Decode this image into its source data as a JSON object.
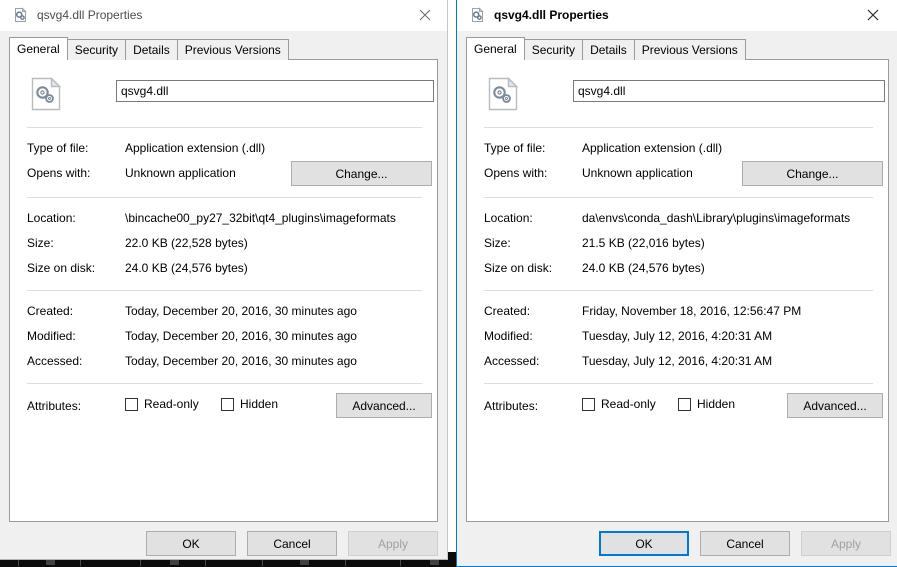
{
  "desktop": {
    "taskbar_present": true,
    "taskbar_color": "#0b0b0b"
  },
  "theme": {
    "accent": "#0078d7",
    "dialog_bg": "#f0f0f0",
    "panel_bg": "#ffffff",
    "button_bg": "#e1e1e1",
    "button_border": "#adadad",
    "separator": "#dedede",
    "disabled_text": "#a0a0a0"
  },
  "tabs": [
    {
      "label": "General",
      "selected": true
    },
    {
      "label": "Security",
      "selected": false
    },
    {
      "label": "Details",
      "selected": false
    },
    {
      "label": "Previous Versions",
      "selected": false
    }
  ],
  "labels": {
    "type_of_file": "Type of file:",
    "opens_with": "Opens with:",
    "location": "Location:",
    "size": "Size:",
    "size_on_disk": "Size on disk:",
    "created": "Created:",
    "modified": "Modified:",
    "accessed": "Accessed:",
    "attributes": "Attributes:"
  },
  "buttons": {
    "change": "Change...",
    "advanced": "Advanced...",
    "ok": "OK",
    "cancel": "Cancel",
    "apply": "Apply",
    "close": "Close"
  },
  "checkboxes": {
    "readonly": "Read-only",
    "hidden": "Hidden"
  },
  "icons": {
    "titlebar": "file-dll-icon",
    "file": "file-dll-icon",
    "close": "close-icon"
  },
  "dialogs": {
    "left": {
      "title": "qsvg4.dll Properties",
      "active": false,
      "filename": "qsvg4.dll",
      "type_of_file": "Application extension (.dll)",
      "opens_with": "Unknown application",
      "location": "\\bincache00_py27_32bit\\qt4_plugins\\imageformats",
      "size": "22.0 KB (22,528 bytes)",
      "size_on_disk": "24.0 KB (24,576 bytes)",
      "created": "Today, December 20, 2016, 30 minutes ago",
      "modified": "Today, December 20, 2016, 30 minutes ago",
      "accessed": "Today, December 20, 2016, 30 minutes ago",
      "readonly_checked": false,
      "hidden_checked": false,
      "ok_is_default": false,
      "apply_enabled": false
    },
    "right": {
      "title": "qsvg4.dll Properties",
      "active": true,
      "filename": "qsvg4.dll",
      "type_of_file": "Application extension (.dll)",
      "opens_with": "Unknown application",
      "location": "da\\envs\\conda_dash\\Library\\plugins\\imageformats",
      "size": "21.5 KB (22,016 bytes)",
      "size_on_disk": "24.0 KB (24,576 bytes)",
      "created": "Friday, November 18, 2016, 12:56:47 PM",
      "modified": "Tuesday, July 12, 2016, 4:20:31 AM",
      "accessed": "Tuesday, July 12, 2016, 4:20:31 AM",
      "readonly_checked": false,
      "hidden_checked": false,
      "ok_is_default": true,
      "apply_enabled": false
    }
  }
}
